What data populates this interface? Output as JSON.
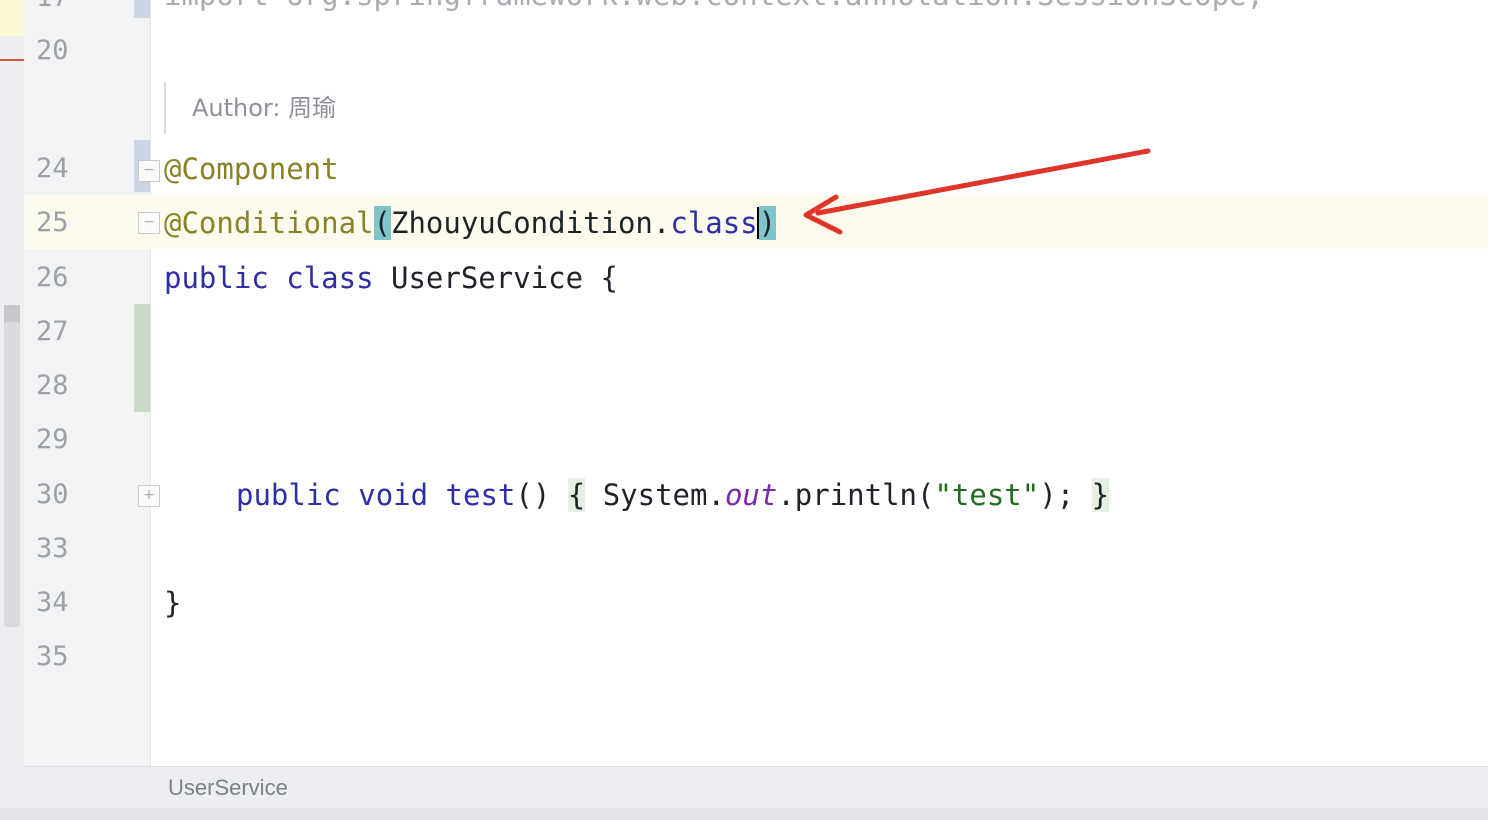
{
  "editor": {
    "partial_top_line": "import org.springframework.web.context.annotation.SessionScope;",
    "inlay_hint": "Author: 周瑜",
    "line_numbers": [
      "17",
      "20",
      "24",
      "25",
      "26",
      "27",
      "28",
      "29",
      "30",
      "33",
      "34",
      "35"
    ],
    "code": {
      "l24_annotation": "@Component",
      "l25_annotation": "@Conditional",
      "l25_open_paren": "(",
      "l25_arg": "ZhouyuCondition.",
      "l25_class_kw": "class",
      "l25_close_paren": ")",
      "l26_public": "public",
      "l26_class": "class",
      "l26_name": " UserService {",
      "l30_public": "public",
      "l30_void": "void",
      "l30_method": "test",
      "l30_parens": "() ",
      "l30_open_brace": "{",
      "l30_system": " System.",
      "l30_out": "out",
      "l30_println": ".println(",
      "l30_string": "\"test\"",
      "l30_end": "); ",
      "l30_close_brace": "}",
      "l34_brace": "}"
    }
  },
  "breadcrumb": {
    "label": "UserService"
  },
  "colors": {
    "keyword": "#2d2ea8",
    "annotation": "#8a8227",
    "arrow": "#e0352b",
    "paren_highlight": "#7fc5c9"
  }
}
